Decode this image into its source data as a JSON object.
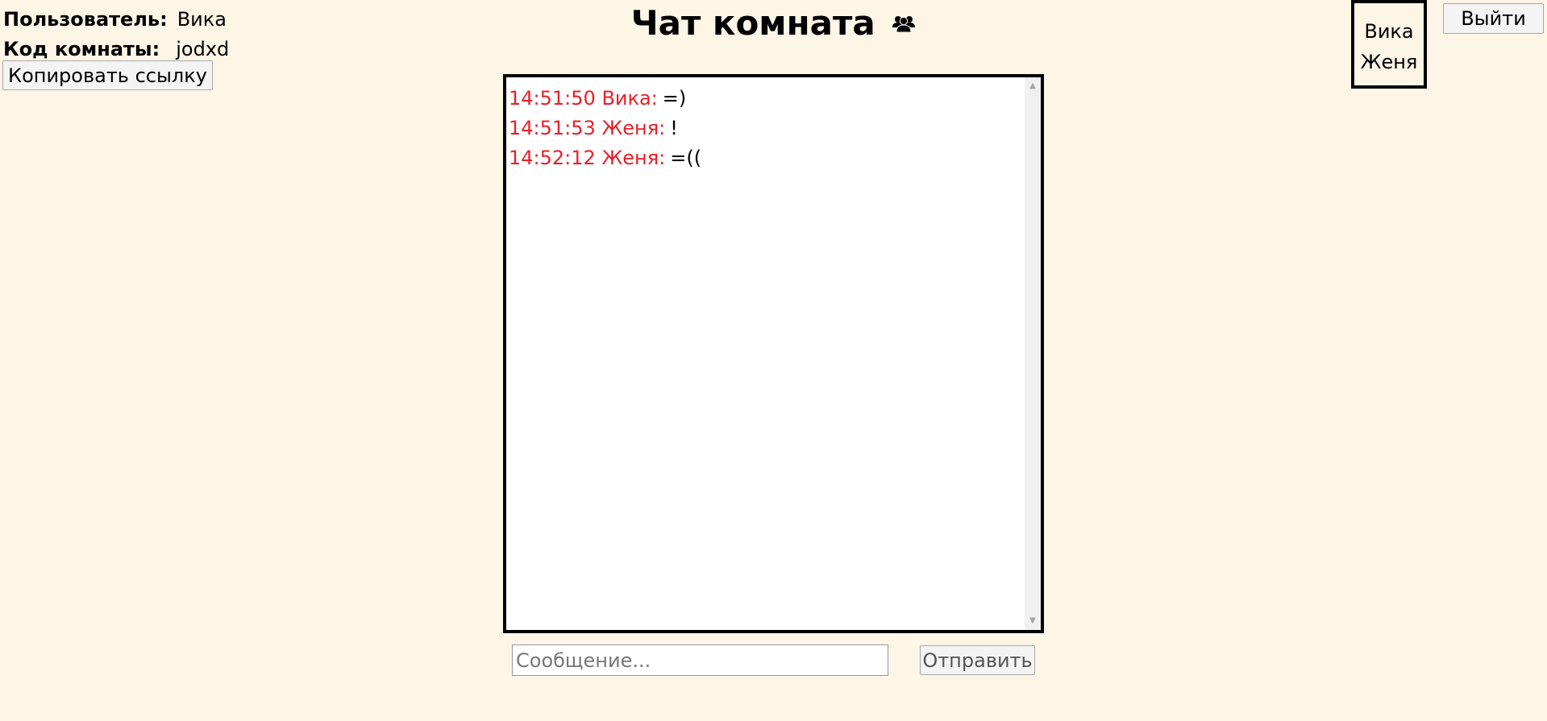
{
  "header": {
    "user_label": "Пользователь:",
    "user_value": "Вика",
    "room_label": "Код комнаты:",
    "room_value": "jodxd",
    "copy_link_label": "Копировать ссылку",
    "title": "Чат комната",
    "title_icon": "users-icon",
    "logout_label": "Выйти"
  },
  "online_users": [
    "Вика",
    "Женя"
  ],
  "messages": [
    {
      "time": "14:51:50",
      "author": "Вика:",
      "text": "=)"
    },
    {
      "time": "14:51:53",
      "author": "Женя:",
      "text": "!"
    },
    {
      "time": "14:52:12",
      "author": "Женя:",
      "text": "=(("
    }
  ],
  "composer": {
    "placeholder": "Сообщение...",
    "value": "",
    "send_label": "Отправить"
  },
  "colors": {
    "background": "#fdf5e6",
    "message_meta": "#e8202a"
  }
}
